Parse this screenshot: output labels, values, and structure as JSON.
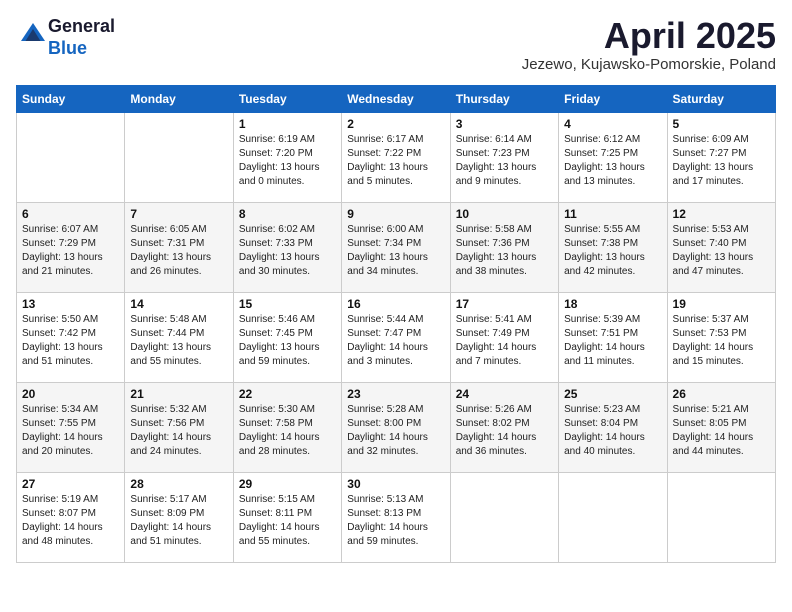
{
  "header": {
    "logo_line1": "General",
    "logo_line2": "Blue",
    "month": "April 2025",
    "location": "Jezewo, Kujawsko-Pomorskie, Poland"
  },
  "weekdays": [
    "Sunday",
    "Monday",
    "Tuesday",
    "Wednesday",
    "Thursday",
    "Friday",
    "Saturday"
  ],
  "weeks": [
    [
      {
        "day": "",
        "info": ""
      },
      {
        "day": "",
        "info": ""
      },
      {
        "day": "1",
        "info": "Sunrise: 6:19 AM\nSunset: 7:20 PM\nDaylight: 13 hours and 0 minutes."
      },
      {
        "day": "2",
        "info": "Sunrise: 6:17 AM\nSunset: 7:22 PM\nDaylight: 13 hours and 5 minutes."
      },
      {
        "day": "3",
        "info": "Sunrise: 6:14 AM\nSunset: 7:23 PM\nDaylight: 13 hours and 9 minutes."
      },
      {
        "day": "4",
        "info": "Sunrise: 6:12 AM\nSunset: 7:25 PM\nDaylight: 13 hours and 13 minutes."
      },
      {
        "day": "5",
        "info": "Sunrise: 6:09 AM\nSunset: 7:27 PM\nDaylight: 13 hours and 17 minutes."
      }
    ],
    [
      {
        "day": "6",
        "info": "Sunrise: 6:07 AM\nSunset: 7:29 PM\nDaylight: 13 hours and 21 minutes."
      },
      {
        "day": "7",
        "info": "Sunrise: 6:05 AM\nSunset: 7:31 PM\nDaylight: 13 hours and 26 minutes."
      },
      {
        "day": "8",
        "info": "Sunrise: 6:02 AM\nSunset: 7:33 PM\nDaylight: 13 hours and 30 minutes."
      },
      {
        "day": "9",
        "info": "Sunrise: 6:00 AM\nSunset: 7:34 PM\nDaylight: 13 hours and 34 minutes."
      },
      {
        "day": "10",
        "info": "Sunrise: 5:58 AM\nSunset: 7:36 PM\nDaylight: 13 hours and 38 minutes."
      },
      {
        "day": "11",
        "info": "Sunrise: 5:55 AM\nSunset: 7:38 PM\nDaylight: 13 hours and 42 minutes."
      },
      {
        "day": "12",
        "info": "Sunrise: 5:53 AM\nSunset: 7:40 PM\nDaylight: 13 hours and 47 minutes."
      }
    ],
    [
      {
        "day": "13",
        "info": "Sunrise: 5:50 AM\nSunset: 7:42 PM\nDaylight: 13 hours and 51 minutes."
      },
      {
        "day": "14",
        "info": "Sunrise: 5:48 AM\nSunset: 7:44 PM\nDaylight: 13 hours and 55 minutes."
      },
      {
        "day": "15",
        "info": "Sunrise: 5:46 AM\nSunset: 7:45 PM\nDaylight: 13 hours and 59 minutes."
      },
      {
        "day": "16",
        "info": "Sunrise: 5:44 AM\nSunset: 7:47 PM\nDaylight: 14 hours and 3 minutes."
      },
      {
        "day": "17",
        "info": "Sunrise: 5:41 AM\nSunset: 7:49 PM\nDaylight: 14 hours and 7 minutes."
      },
      {
        "day": "18",
        "info": "Sunrise: 5:39 AM\nSunset: 7:51 PM\nDaylight: 14 hours and 11 minutes."
      },
      {
        "day": "19",
        "info": "Sunrise: 5:37 AM\nSunset: 7:53 PM\nDaylight: 14 hours and 15 minutes."
      }
    ],
    [
      {
        "day": "20",
        "info": "Sunrise: 5:34 AM\nSunset: 7:55 PM\nDaylight: 14 hours and 20 minutes."
      },
      {
        "day": "21",
        "info": "Sunrise: 5:32 AM\nSunset: 7:56 PM\nDaylight: 14 hours and 24 minutes."
      },
      {
        "day": "22",
        "info": "Sunrise: 5:30 AM\nSunset: 7:58 PM\nDaylight: 14 hours and 28 minutes."
      },
      {
        "day": "23",
        "info": "Sunrise: 5:28 AM\nSunset: 8:00 PM\nDaylight: 14 hours and 32 minutes."
      },
      {
        "day": "24",
        "info": "Sunrise: 5:26 AM\nSunset: 8:02 PM\nDaylight: 14 hours and 36 minutes."
      },
      {
        "day": "25",
        "info": "Sunrise: 5:23 AM\nSunset: 8:04 PM\nDaylight: 14 hours and 40 minutes."
      },
      {
        "day": "26",
        "info": "Sunrise: 5:21 AM\nSunset: 8:05 PM\nDaylight: 14 hours and 44 minutes."
      }
    ],
    [
      {
        "day": "27",
        "info": "Sunrise: 5:19 AM\nSunset: 8:07 PM\nDaylight: 14 hours and 48 minutes."
      },
      {
        "day": "28",
        "info": "Sunrise: 5:17 AM\nSunset: 8:09 PM\nDaylight: 14 hours and 51 minutes."
      },
      {
        "day": "29",
        "info": "Sunrise: 5:15 AM\nSunset: 8:11 PM\nDaylight: 14 hours and 55 minutes."
      },
      {
        "day": "30",
        "info": "Sunrise: 5:13 AM\nSunset: 8:13 PM\nDaylight: 14 hours and 59 minutes."
      },
      {
        "day": "",
        "info": ""
      },
      {
        "day": "",
        "info": ""
      },
      {
        "day": "",
        "info": ""
      }
    ]
  ]
}
